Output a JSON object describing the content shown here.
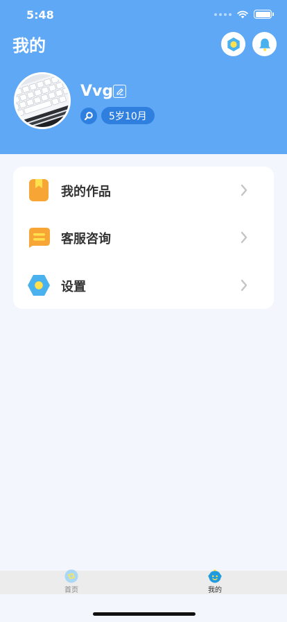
{
  "status_bar": {
    "time": "5:48"
  },
  "header": {
    "title": "我的",
    "background_color": "#5fa8f6",
    "settings_icon": "gear-icon",
    "bell_icon": "bell-icon"
  },
  "profile": {
    "username": "Vvg",
    "age": "5岁10月",
    "avatar_icon": "keyboard-photo"
  },
  "menu": {
    "items": [
      {
        "label": "我的作品",
        "icon": "bookmark-icon",
        "color": "#f7a635"
      },
      {
        "label": "客服咨询",
        "icon": "chat-icon",
        "color": "#f7a635"
      },
      {
        "label": "设置",
        "icon": "hexagon-gear-icon",
        "color": "#4ab1ef"
      }
    ]
  },
  "tabbar": {
    "tabs": [
      {
        "label": "首页",
        "icon": "compass-icon",
        "active": false
      },
      {
        "label": "我的",
        "icon": "baby-face-icon",
        "active": true
      }
    ]
  }
}
